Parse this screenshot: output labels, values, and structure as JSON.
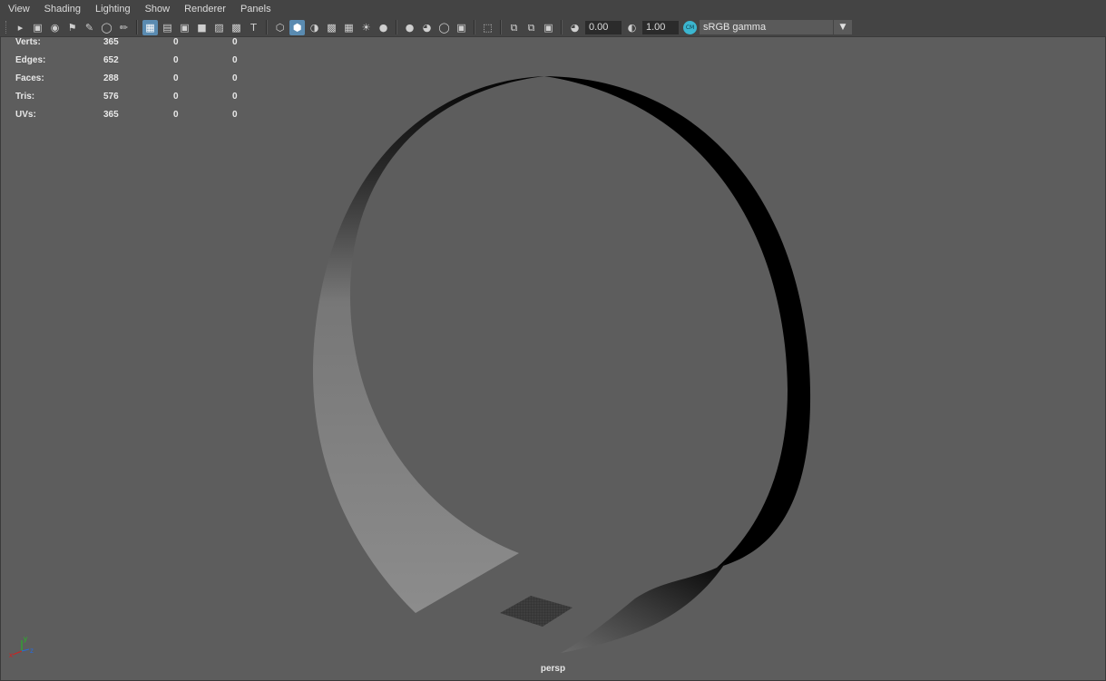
{
  "menu": [
    "View",
    "Shading",
    "Lighting",
    "Show",
    "Renderer",
    "Panels"
  ],
  "toolbar": {
    "exposure_value": "0.00",
    "gamma_value": "1.00",
    "color_space": "sRGB gamma"
  },
  "hud": {
    "rows": [
      {
        "label": "Verts:",
        "c1": "365",
        "c2": "0",
        "c3": "0"
      },
      {
        "label": "Edges:",
        "c1": "652",
        "c2": "0",
        "c3": "0"
      },
      {
        "label": "Faces:",
        "c1": "288",
        "c2": "0",
        "c3": "0"
      },
      {
        "label": "Tris:",
        "c1": "576",
        "c2": "0",
        "c3": "0"
      },
      {
        "label": "UVs:",
        "c1": "365",
        "c2": "0",
        "c3": "0"
      }
    ]
  },
  "viewport": {
    "camera_label": "persp",
    "axis_labels": {
      "x": "x",
      "y": "y",
      "z": "z"
    }
  },
  "colors": {
    "background": "#5d5d5d",
    "menubar": "#444444",
    "active_button": "#5a8bb1",
    "axis_x": "#d02020",
    "axis_y": "#20c020",
    "axis_z": "#2a6ad8"
  }
}
